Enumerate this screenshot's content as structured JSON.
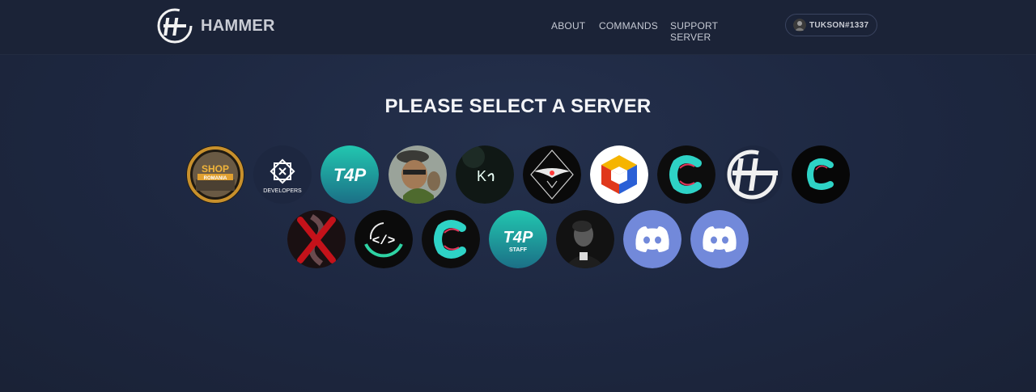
{
  "brand": {
    "name": "HAMMER"
  },
  "nav": {
    "about": "ABOUT",
    "commands": "COMMANDS",
    "support": "SUPPORT SERVER"
  },
  "user": {
    "name": "TUKSON#1337"
  },
  "title": "PLEASE SELECT A SERVER",
  "servers_row1": [
    {
      "icon": "shop-romania-icon",
      "text": "SHOP",
      "subtext": "ROMANIA"
    },
    {
      "icon": "developers-icon",
      "text": "DEVELOPERS"
    },
    {
      "icon": "t4p-icon",
      "text": "T4P"
    },
    {
      "icon": "cartoon-man-icon"
    },
    {
      "icon": "ks-icon",
      "text": "K"
    },
    {
      "icon": "eagle-emblem-icon"
    },
    {
      "icon": "cube-logo-icon"
    },
    {
      "icon": "teal-c-icon"
    },
    {
      "icon": "hammer-logo-icon"
    },
    {
      "icon": "teal-c-icon"
    }
  ],
  "servers_row2": [
    {
      "icon": "red-x-icon"
    },
    {
      "icon": "code-icon",
      "text": "</>"
    },
    {
      "icon": "teal-c-icon"
    },
    {
      "icon": "t4p-staff-icon",
      "text": "T4P",
      "subtext": "STAFF"
    },
    {
      "icon": "portrait-icon"
    },
    {
      "icon": "discord-default-icon"
    },
    {
      "icon": "discord-default-icon"
    }
  ],
  "colors": {
    "background": "#1d2740",
    "navbar": "#1b2337",
    "t4p_teal": "#1fb5a6",
    "discord_blurple": "#7289da"
  }
}
